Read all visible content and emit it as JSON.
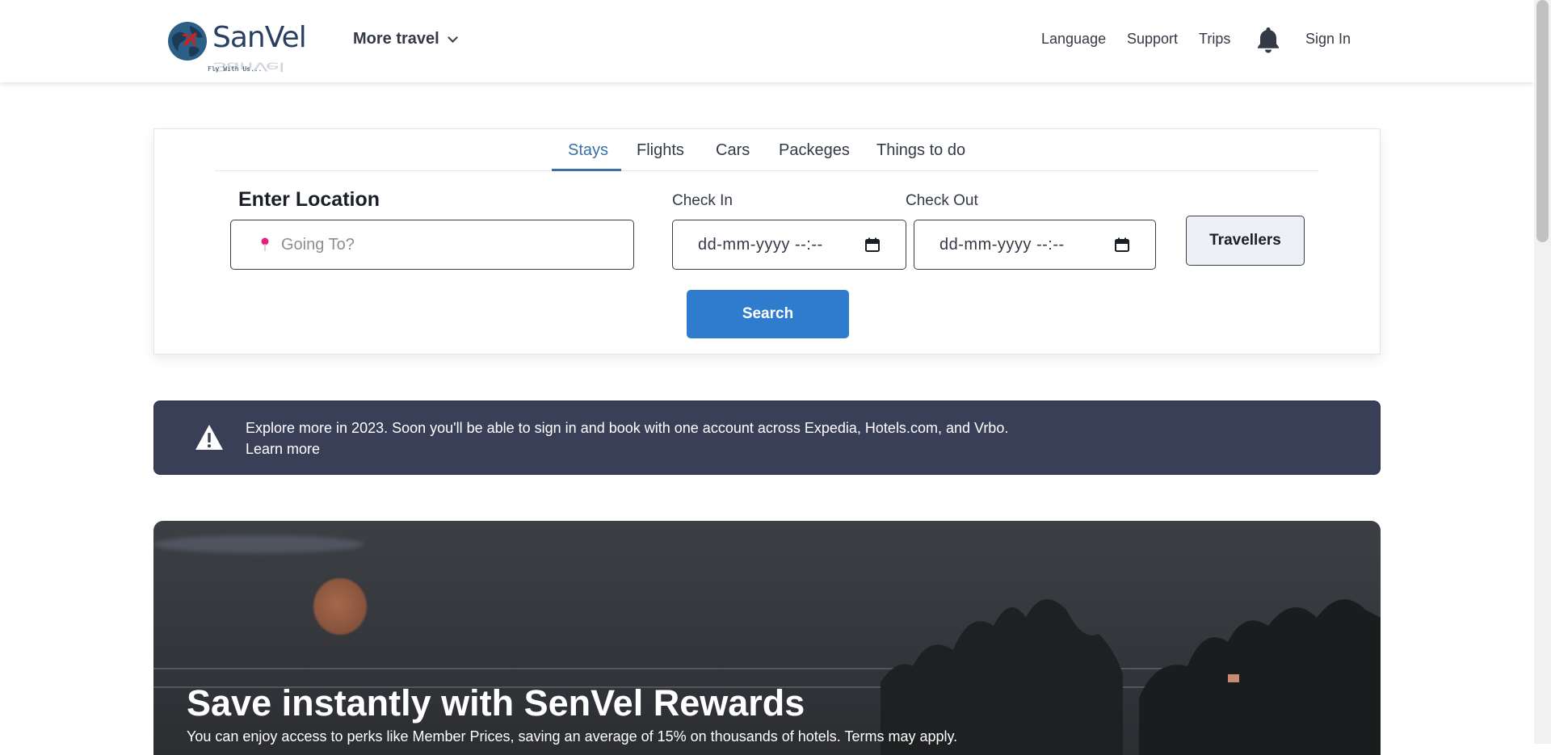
{
  "header": {
    "logo_text": "SanVel",
    "logo_tagline": "Fly With Us...",
    "more_travel": "More travel",
    "nav": [
      "Language",
      "Support",
      "Trips"
    ],
    "sign_in": "Sign In"
  },
  "search": {
    "tabs": [
      {
        "label": "Stays",
        "active": true
      },
      {
        "label": "Flights"
      },
      {
        "label": "Cars"
      },
      {
        "label": "Packeges"
      },
      {
        "label": "Things to do"
      }
    ],
    "location_label": "Enter Location",
    "location_placeholder": "Going To?",
    "checkin_label": "Check In",
    "checkin_value": "dd-mm-yyyy --:--",
    "checkout_label": "Check Out",
    "checkout_value": "dd-mm-yyyy --:--",
    "travellers_label": "Travellers",
    "search_label": "Search"
  },
  "notice": {
    "message": "Explore more in 2023. Soon you'll be able to sign in and book with one account across Expedia, Hotels.com, and Vrbo.",
    "link": "Learn more"
  },
  "hero": {
    "title": "Save instantly with SenVel Rewards",
    "subtitle": "You can enjoy access to perks like Member Prices, saving an average of 15% on thousands of hotels. Terms may apply."
  },
  "colors": {
    "accent": "#2f7ccf",
    "tab_active": "#3a6fa8",
    "notice_bg": "#393f57",
    "pin": "#e0207a"
  },
  "icons": [
    "globe-logo-icon",
    "chevron-down-icon",
    "bell-icon",
    "location-pin-icon",
    "calendar-icon",
    "warning-icon"
  ]
}
